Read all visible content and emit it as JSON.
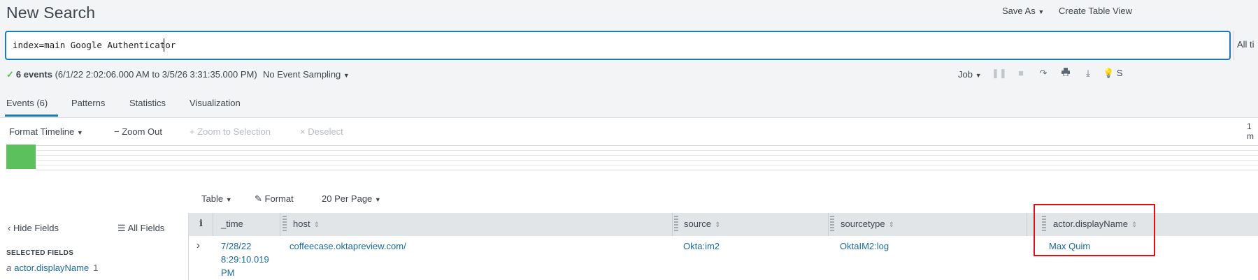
{
  "header": {
    "title": "New Search",
    "save_as": "Save As",
    "create_table_view": "Create Table View"
  },
  "search": {
    "query": "index=main Google Authenticator",
    "time_range": "All ti"
  },
  "summary": {
    "check": "✓",
    "events": "6 events",
    "range": "(6/1/22 2:02:06.000 AM to 3/5/26 3:31:35.000 PM)",
    "sampling": "No Event Sampling"
  },
  "job": {
    "label": "Job",
    "smart_mode": "S"
  },
  "tabs": {
    "events": "Events (6)",
    "patterns": "Patterns",
    "statistics": "Statistics",
    "visualization": "Visualization"
  },
  "timeline": {
    "format": "Format Timeline",
    "zoom_out": "Zoom Out",
    "zoom_selection": "Zoom to Selection",
    "deselect": "Deselect",
    "scale": "1 m"
  },
  "results_options": {
    "table": "Table",
    "format": "Format",
    "per_page": "20 Per Page"
  },
  "fields_panel": {
    "hide_fields": "Hide Fields",
    "all_fields": "All Fields",
    "selected_label": "SELECTED FIELDS",
    "selected": [
      {
        "type": "a",
        "name": "actor.displayName",
        "count": "1"
      }
    ]
  },
  "table": {
    "info_header": "i",
    "columns": [
      "_time",
      "host",
      "source",
      "sourcetype",
      "actor.displayName"
    ],
    "rows": [
      {
        "time_line1": "7/28/22",
        "time_line2": "8:29:10.019",
        "time_line3": "PM",
        "host": "coffeecase.oktapreview.com/",
        "source": "Okta:im2",
        "sourcetype": "OktaIM2:log",
        "actor_displayName": "Max Quim"
      }
    ]
  },
  "icons": {
    "expand": "chevron-right-icon",
    "pause": "pause-icon",
    "stop": "stop-icon",
    "share": "share-icon",
    "print": "print-icon",
    "export": "download-icon",
    "smart": "lightbulb-icon"
  },
  "colors": {
    "accent": "#1a7cb7",
    "link": "#1a6ba0",
    "timeline_bar": "#5cc05c",
    "highlight": "#e01010"
  }
}
